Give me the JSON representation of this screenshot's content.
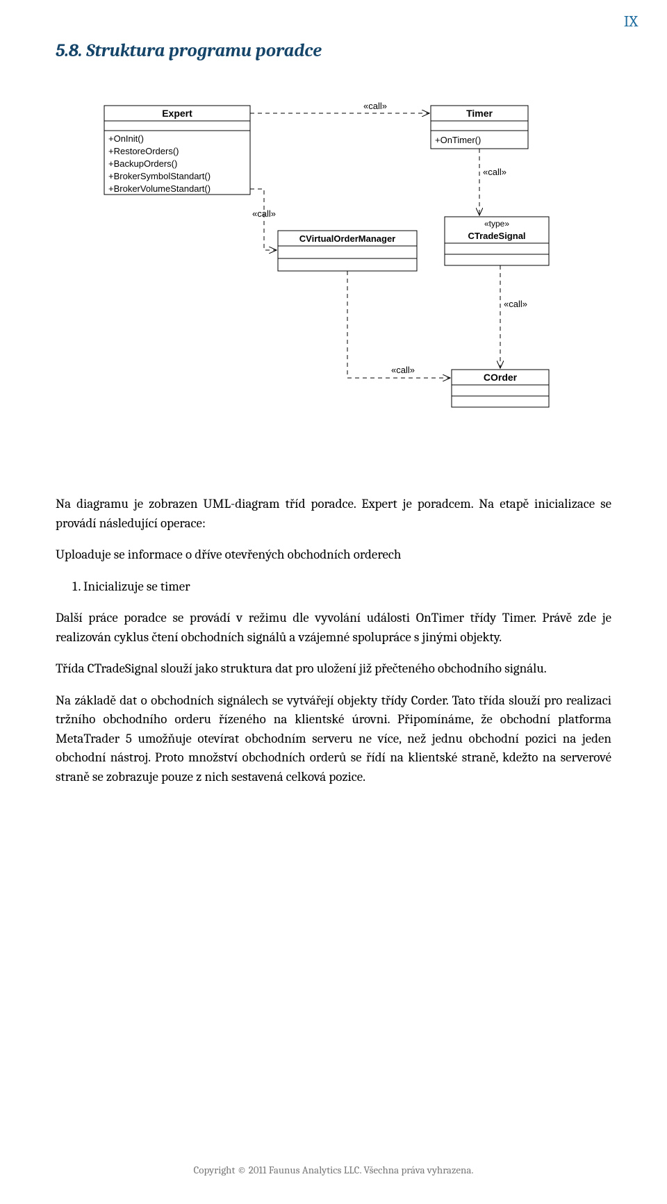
{
  "pageNumber": "IX",
  "sectionTitle": "5.8.  Struktura programu poradce",
  "diagram": {
    "expert": {
      "title": "Expert",
      "ops": [
        "+OnInit()",
        "+RestoreOrders()",
        "+BackupOrders()",
        "+BrokerSymbolStandart()",
        "+BrokerVolumeStandart()"
      ]
    },
    "timer": {
      "title": "Timer",
      "ops": [
        "+OnTimer()"
      ]
    },
    "cvom": {
      "title": "CVirtualOrderManager"
    },
    "ctradesignal": {
      "stereotype": "«type»",
      "title": "CTradeSignal"
    },
    "corder": {
      "title": "COrder"
    },
    "labels": {
      "call": "«call»"
    }
  },
  "chart_data": {
    "type": "uml-class-diagram",
    "classes": [
      {
        "name": "Expert",
        "stereotype": null,
        "operations": [
          "+OnInit()",
          "+RestoreOrders()",
          "+BackupOrders()",
          "+BrokerSymbolStandart()",
          "+BrokerVolumeStandart()"
        ]
      },
      {
        "name": "Timer",
        "stereotype": null,
        "operations": [
          "+OnTimer()"
        ]
      },
      {
        "name": "CVirtualOrderManager",
        "stereotype": null,
        "operations": []
      },
      {
        "name": "CTradeSignal",
        "stereotype": "«type»",
        "operations": []
      },
      {
        "name": "COrder",
        "stereotype": null,
        "operations": []
      }
    ],
    "relations": [
      {
        "from": "Expert",
        "to": "Timer",
        "type": "dependency",
        "label": "«call»"
      },
      {
        "from": "Expert",
        "to": "CVirtualOrderManager",
        "type": "dependency",
        "label": "«call»"
      },
      {
        "from": "Timer",
        "to": "CTradeSignal",
        "type": "dependency",
        "label": "«call»"
      },
      {
        "from": "CVirtualOrderManager",
        "to": "COrder",
        "type": "dependency",
        "label": "«call»"
      },
      {
        "from": "CTradeSignal",
        "to": "COrder",
        "type": "dependency",
        "label": "«call»"
      }
    ]
  },
  "paragraphs": {
    "p1": "Na diagramu je zobrazen UML-diagram tříd poradce. Expert je poradcem. Na etapě inicializace se provádí následující operace:",
    "p2": "Uploaduje se informace o dříve otevřených obchodních orderech",
    "list1": "Inicializuje se timer",
    "p3": "Další práce poradce se provádí v režimu dle vyvolání události OnTimer třídy Timer. Právě zde je realizován cyklus čtení obchodních signálů a vzájemné spolupráce s jinými objekty.",
    "p4": "Třída CTradeSignal slouží jako struktura dat pro uložení již přečteného obchodního signálu.",
    "p5": "Na základě dat o obchodních signálech se vytvářejí objekty třídy Corder. Tato třída slouží pro realizaci tržního obchodního orderu řízeného na klientské úrovni. Připomínáme, že obchodní platforma MetaTrader 5 umožňuje otevírat obchodním serveru ne více, než jednu obchodní pozici na jeden obchodní nástroj. Proto množství obchodních orderů se řídí na klientské straně, kdežto na serverové straně se zobrazuje pouze z nich sestavená celková pozice."
  },
  "footer": "Copyright © 2011 Faunus Analytics LLC. Všechna práva vyhrazena."
}
